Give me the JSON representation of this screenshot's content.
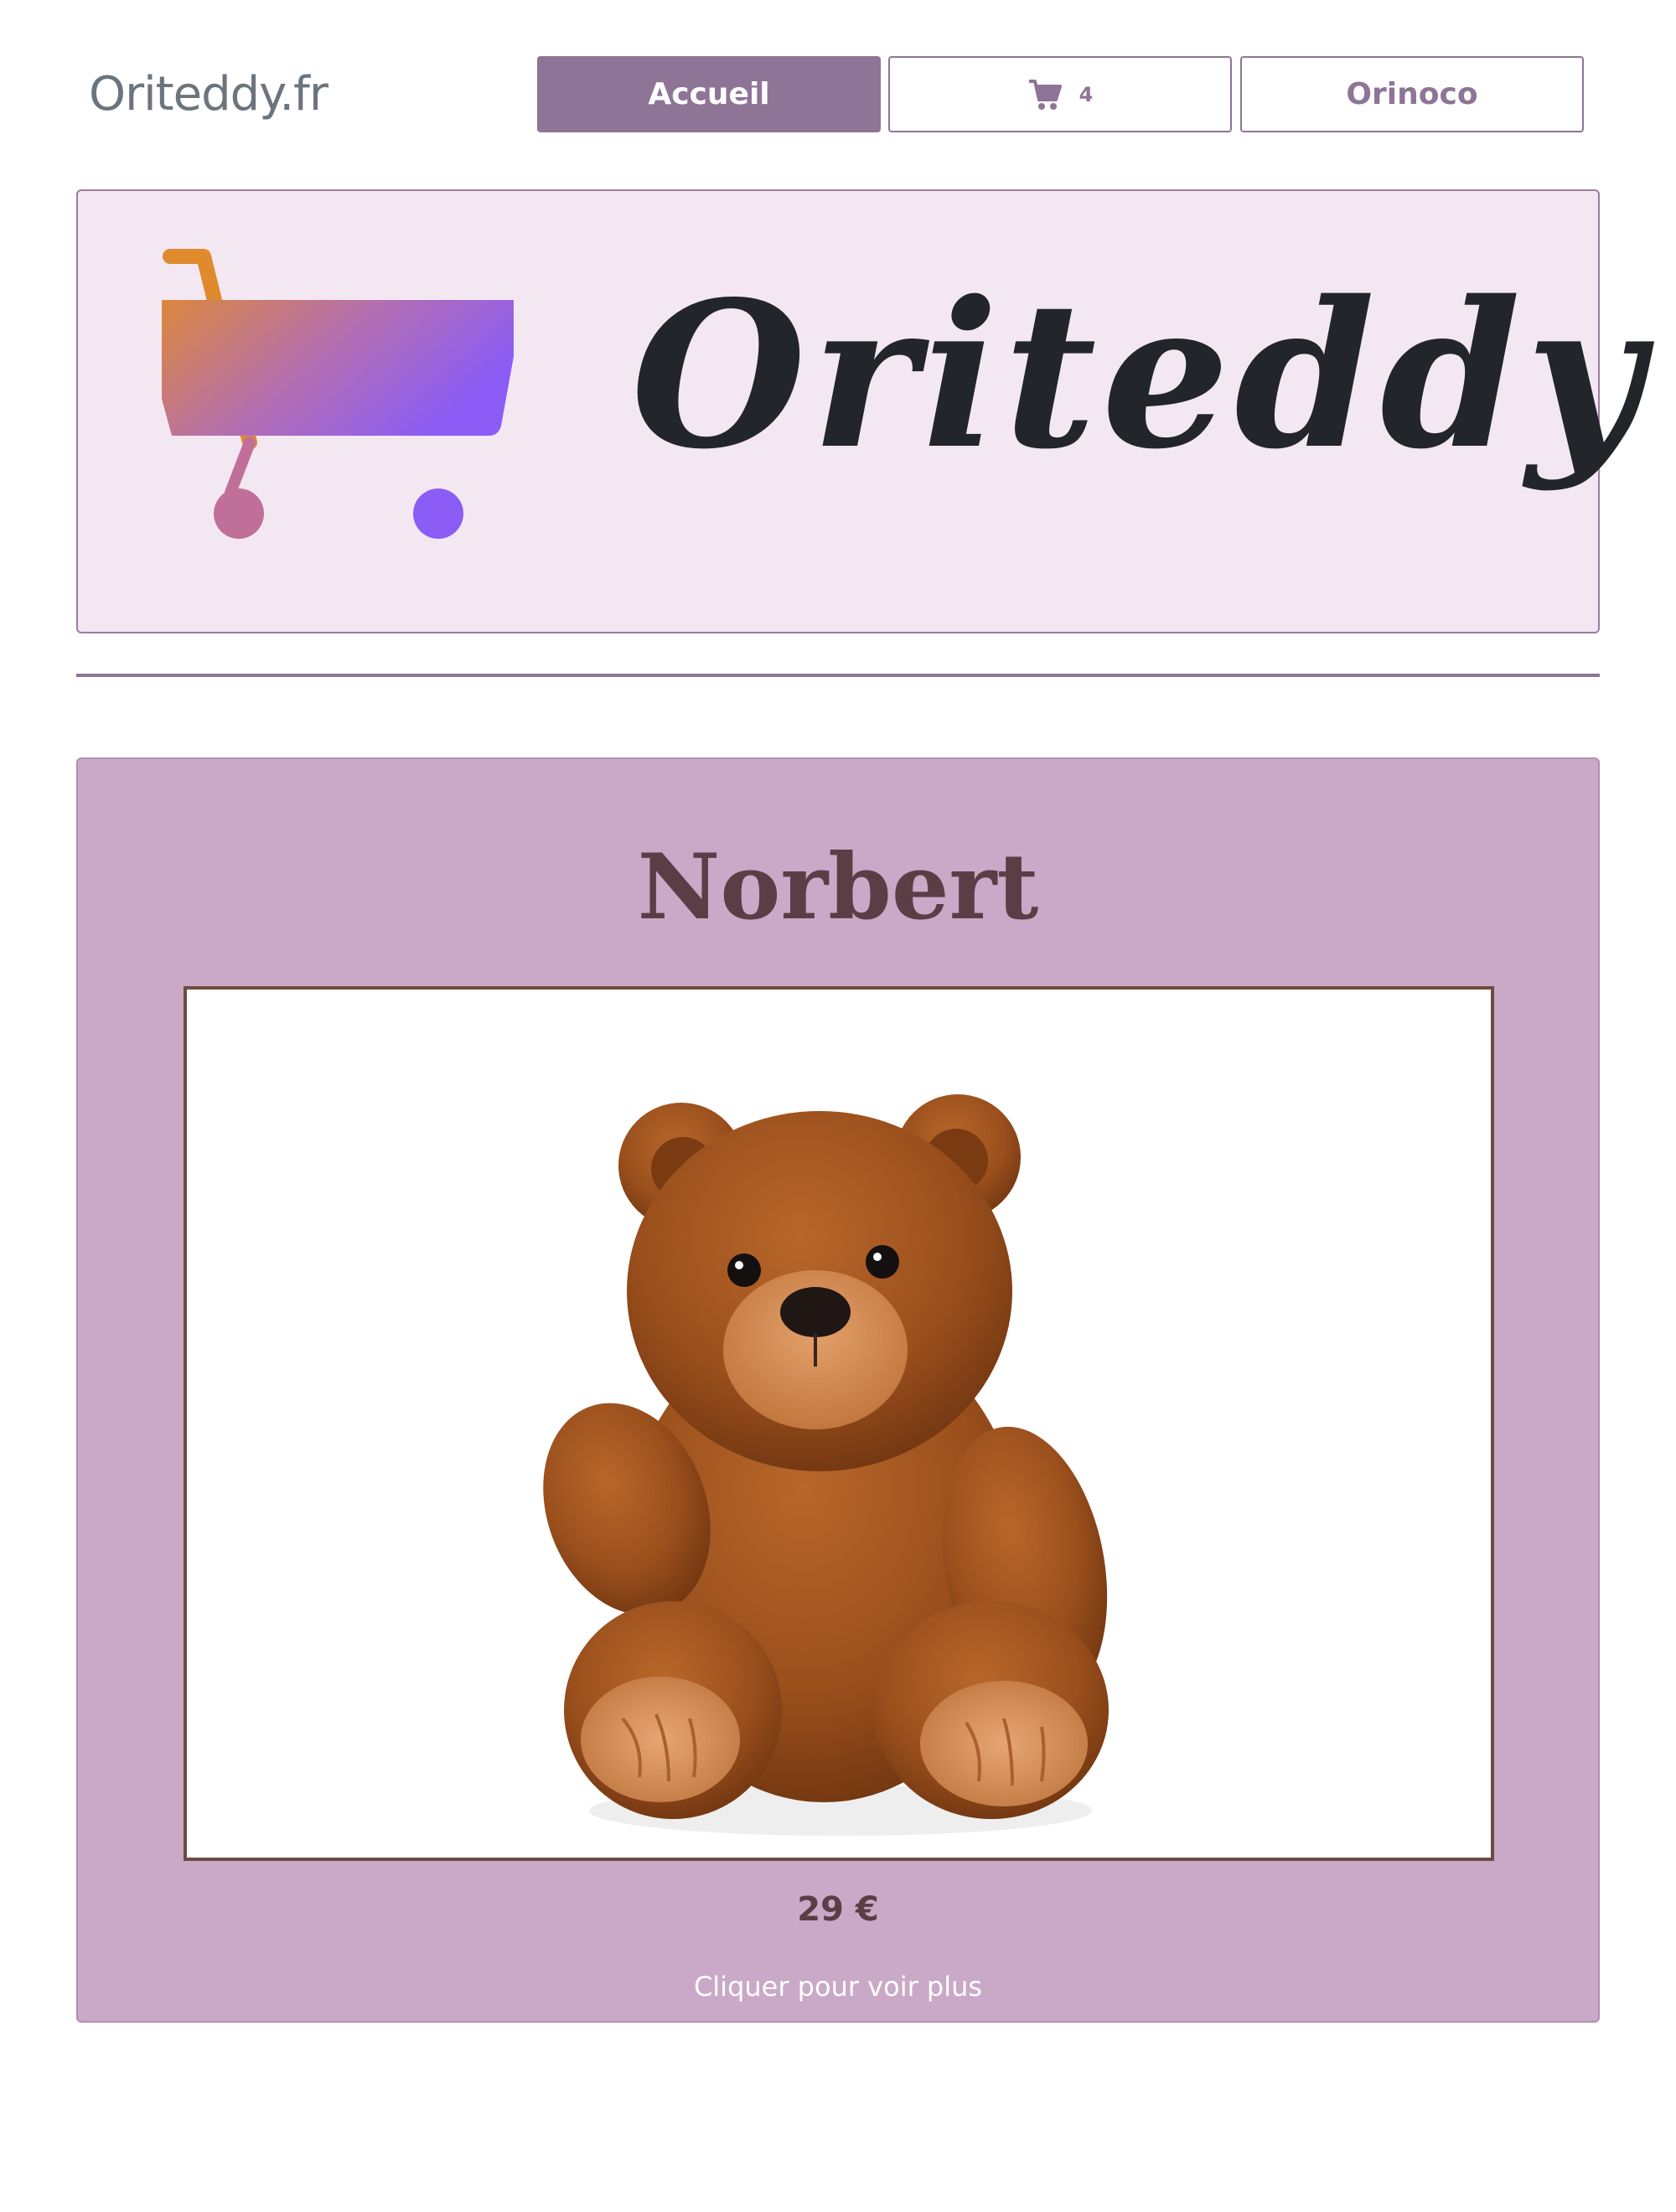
{
  "navbar": {
    "brand": "Oriteddy.fr",
    "home_label": "Accueil",
    "cart_icon": "shopping-cart-icon",
    "cart_count": "4",
    "orinoco_label": "Orinoco"
  },
  "banner": {
    "cart_icon": "shopping-cart-gradient-icon",
    "title": "Oriteddy"
  },
  "product": {
    "name": "Norbert",
    "image": "teddy-bear-photo",
    "price": "29 €",
    "cta": "Cliquer pour voir plus"
  },
  "colors": {
    "accent": "#8e7497",
    "banner_bg": "#f3e8f2",
    "card_bg": "#c9a8c8",
    "title_dark": "#5b3d46",
    "cart_gradient_start": "#e08a2e",
    "cart_gradient_end": "#8b5cf6"
  }
}
